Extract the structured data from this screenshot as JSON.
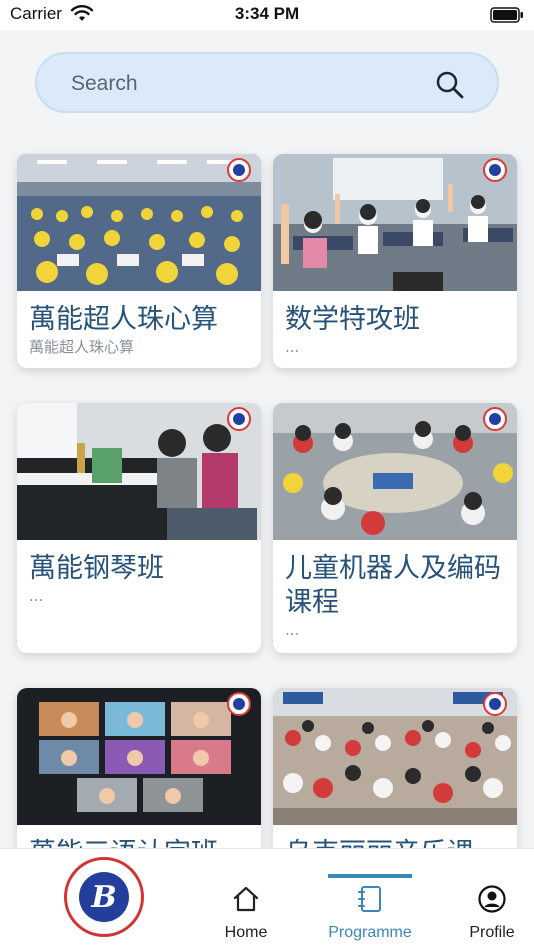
{
  "status_bar": {
    "carrier": "Carrier",
    "time": "3:34 PM"
  },
  "search": {
    "placeholder": "Search",
    "icon": "search-icon"
  },
  "programmes": [
    {
      "title": "萬能超人珠心算",
      "subtitle": "萬能超人珠心算",
      "photo": "abacus-class-photo"
    },
    {
      "title": "数学特攻班",
      "subtitle": "...",
      "photo": "math-class-photo"
    },
    {
      "title": "萬能钢琴班",
      "subtitle": "...",
      "photo": "piano-class-photo"
    },
    {
      "title": "儿童机器人及编码课程",
      "subtitle": "...",
      "photo": "robotics-class-photo"
    },
    {
      "title": "萬能三语认字班",
      "subtitle": "",
      "photo": "online-class-photo"
    },
    {
      "title": "乌克丽丽音乐课",
      "subtitle": "",
      "photo": "ukulele-class-photo"
    }
  ],
  "tab_bar": {
    "logo_letter": "B",
    "tabs": [
      {
        "label": "Home",
        "icon": "home-icon",
        "active": false
      },
      {
        "label": "Programme",
        "icon": "notebook-icon",
        "active": true
      },
      {
        "label": "Profile",
        "icon": "user-circle-icon",
        "active": false
      }
    ]
  },
  "colors": {
    "accent": "#3a88b8",
    "title_text": "#27527a",
    "search_background": "#daeaf8",
    "inactive_tab": "#222222"
  }
}
